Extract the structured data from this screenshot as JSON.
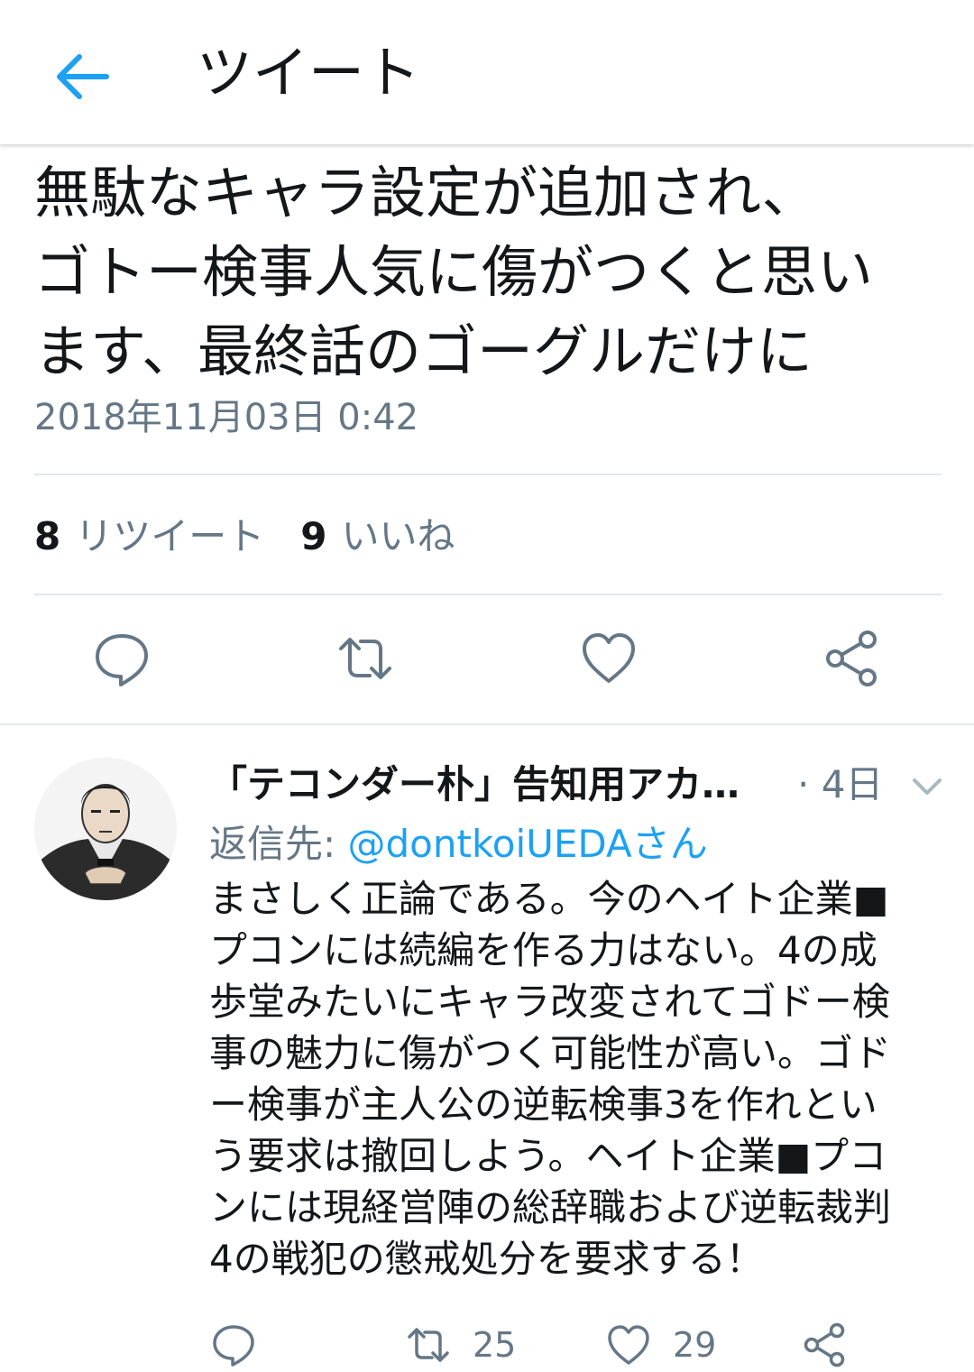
{
  "header": {
    "title": "ツイート"
  },
  "tweet": {
    "text": "無駄なキャラ設定が追加され、\nゴトー検事人気に傷がつくと思い\nます、最終話のゴーグルだけに",
    "timestamp": "2018年11月03日 0:42",
    "retweet_count": "8",
    "retweet_label": "リツイート",
    "like_count": "9",
    "like_label": "いいね"
  },
  "reply": {
    "name": "「テコンダー朴」告知用アカ…",
    "time": "· 4日",
    "reply_to_prefix": "返信先: ",
    "reply_to_handle": "@dontkoiUEDAさん",
    "body": "まさしく正論である。今のヘイト企業■\nプコンには続編を作る力はない。4の成\n歩堂みたいにキャラ改変されてゴドー検\n事の魅力に傷がつく可能性が高い。ゴド\nー検事が主人公の逆転検事3を作れとい\nう要求は撤回しよう。ヘイト企業■プコ\nンには現経営陣の総辞職および逆転裁判\n4の戦犯の懲戒処分を要求する！",
    "retweet_count": "25",
    "like_count": "29"
  },
  "colors": {
    "accent": "#1da1f2",
    "secondary_text": "#657786",
    "icon": "#657786"
  }
}
